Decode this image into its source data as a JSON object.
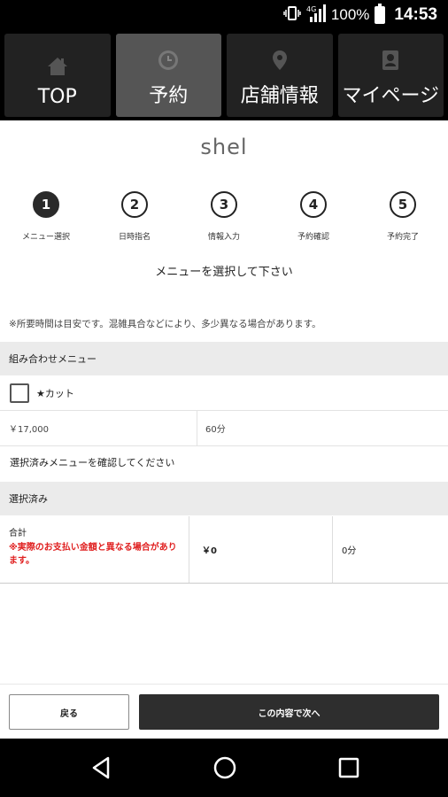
{
  "status_bar": {
    "network": "4G",
    "battery": "100%",
    "time": "14:53"
  },
  "nav": {
    "tabs": [
      {
        "label": "TOP",
        "icon": "home-icon",
        "active": false
      },
      {
        "label": "予約",
        "icon": "clock-icon",
        "active": true
      },
      {
        "label": "店舗情報",
        "icon": "location-pin-icon",
        "active": false
      },
      {
        "label": "マイページ",
        "icon": "user-card-icon",
        "active": false
      }
    ]
  },
  "shop_name": "shel",
  "steps": [
    {
      "number": "1",
      "label": "メニュー選択",
      "done": true
    },
    {
      "number": "2",
      "label": "日時指名",
      "done": false
    },
    {
      "number": "3",
      "label": "情報入力",
      "done": false
    },
    {
      "number": "4",
      "label": "予約確認",
      "done": false
    },
    {
      "number": "5",
      "label": "予約完了",
      "done": false
    }
  ],
  "instruction": "メニューを選択して下さい",
  "note": "※所要時間は目安です。混雑具合などにより、多少異なる場合があります。",
  "combo_section": {
    "header": "組み合わせメニュー",
    "item": {
      "name": "★カット",
      "price": "￥17,000",
      "duration": "60分",
      "checked": false
    }
  },
  "confirm_text": "選択済みメニューを確認してください",
  "selected_section": {
    "header": "選択済み",
    "total_label": "合計",
    "warning": "※実際のお支払い金額と異なる場合があります。",
    "total_price": "￥0",
    "total_time": "0分"
  },
  "buttons": {
    "back": "戻る",
    "next": "この内容で次へ"
  },
  "colors": {
    "accent_dark": "#2e2e2e",
    "warning": "#e02020",
    "header_bg": "#ebebeb"
  }
}
